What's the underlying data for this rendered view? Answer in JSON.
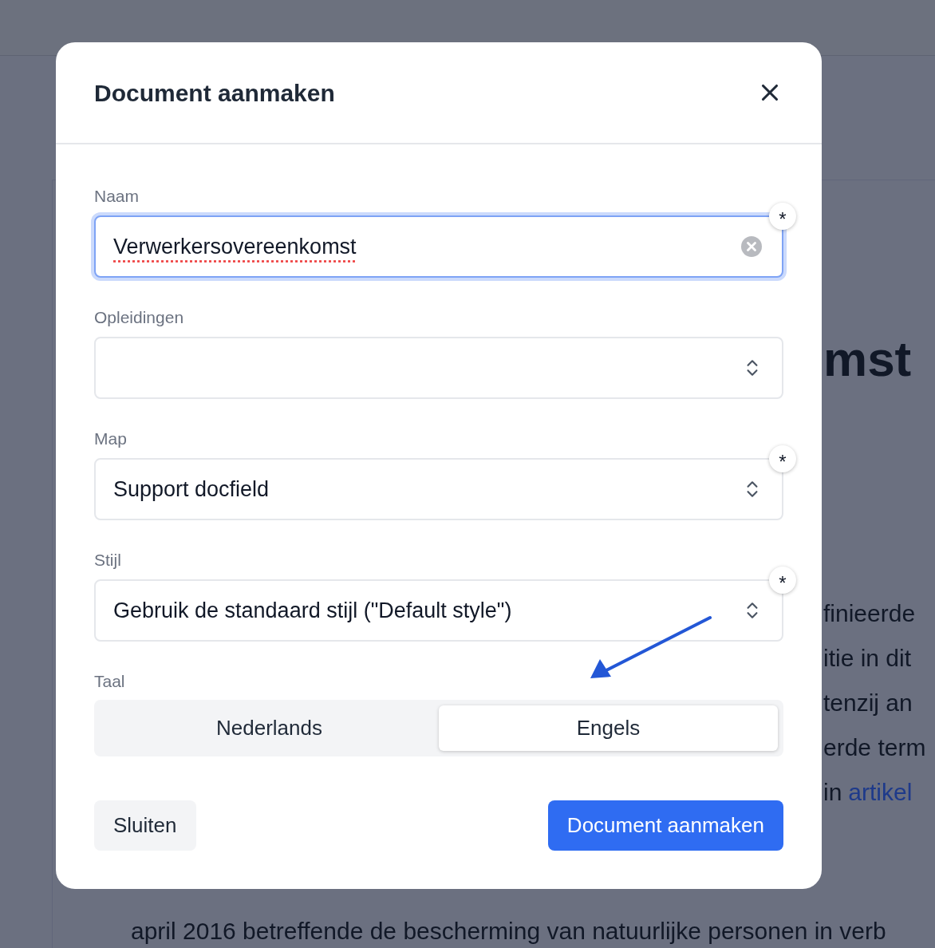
{
  "background_page": {
    "heading": "mst",
    "lines": [
      {
        "text": "finieerde"
      },
      {
        "text": "itie in dit"
      },
      {
        "text": "tenzij an"
      },
      {
        "text": "erde term"
      },
      {
        "text": "in",
        "link": "artikel"
      }
    ],
    "bottom_lines": [
      {
        "text": "april 2016 betreffende de bescherming van natuurlijke personen in verb"
      }
    ]
  },
  "dialog": {
    "title": "Document aanmaken",
    "fields": [
      {
        "kind": "text",
        "label": "Naam",
        "value": "Verwerkersovereenkomst",
        "required_mark": "*",
        "focused": true,
        "spelling_error": true
      },
      {
        "kind": "select",
        "label": "Opleidingen",
        "focused": false
      },
      {
        "kind": "select",
        "label": "Map",
        "value": "Support docfield",
        "required_mark": "*",
        "focused": false
      },
      {
        "kind": "select",
        "label": "Stijl",
        "value": "Gebruik de standaard stijl (\"Default style\")",
        "required_mark": "*",
        "focused": false
      }
    ],
    "language": {
      "label": "Taal",
      "options": [
        {
          "label": "Nederlands",
          "selected": false
        },
        {
          "label": "Engels",
          "selected": true
        }
      ]
    },
    "buttons": [
      {
        "label": "Sluiten",
        "kind": "secondary"
      },
      {
        "label": "Document aanmaken",
        "kind": "primary"
      }
    ]
  },
  "annotation": {
    "kind": "arrow"
  }
}
